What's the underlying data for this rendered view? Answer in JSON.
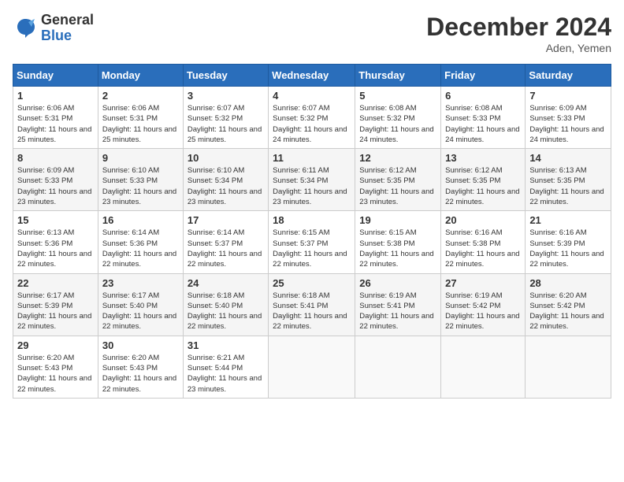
{
  "logo": {
    "general": "General",
    "blue": "Blue"
  },
  "title": "December 2024",
  "location": "Aden, Yemen",
  "days_header": [
    "Sunday",
    "Monday",
    "Tuesday",
    "Wednesday",
    "Thursday",
    "Friday",
    "Saturday"
  ],
  "weeks": [
    [
      {
        "day": "1",
        "sunrise": "6:06 AM",
        "sunset": "5:31 PM",
        "daylight": "11 hours and 25 minutes."
      },
      {
        "day": "2",
        "sunrise": "6:06 AM",
        "sunset": "5:31 PM",
        "daylight": "11 hours and 25 minutes."
      },
      {
        "day": "3",
        "sunrise": "6:07 AM",
        "sunset": "5:32 PM",
        "daylight": "11 hours and 25 minutes."
      },
      {
        "day": "4",
        "sunrise": "6:07 AM",
        "sunset": "5:32 PM",
        "daylight": "11 hours and 24 minutes."
      },
      {
        "day": "5",
        "sunrise": "6:08 AM",
        "sunset": "5:32 PM",
        "daylight": "11 hours and 24 minutes."
      },
      {
        "day": "6",
        "sunrise": "6:08 AM",
        "sunset": "5:33 PM",
        "daylight": "11 hours and 24 minutes."
      },
      {
        "day": "7",
        "sunrise": "6:09 AM",
        "sunset": "5:33 PM",
        "daylight": "11 hours and 24 minutes."
      }
    ],
    [
      {
        "day": "8",
        "sunrise": "6:09 AM",
        "sunset": "5:33 PM",
        "daylight": "11 hours and 23 minutes."
      },
      {
        "day": "9",
        "sunrise": "6:10 AM",
        "sunset": "5:33 PM",
        "daylight": "11 hours and 23 minutes."
      },
      {
        "day": "10",
        "sunrise": "6:10 AM",
        "sunset": "5:34 PM",
        "daylight": "11 hours and 23 minutes."
      },
      {
        "day": "11",
        "sunrise": "6:11 AM",
        "sunset": "5:34 PM",
        "daylight": "11 hours and 23 minutes."
      },
      {
        "day": "12",
        "sunrise": "6:12 AM",
        "sunset": "5:35 PM",
        "daylight": "11 hours and 23 minutes."
      },
      {
        "day": "13",
        "sunrise": "6:12 AM",
        "sunset": "5:35 PM",
        "daylight": "11 hours and 22 minutes."
      },
      {
        "day": "14",
        "sunrise": "6:13 AM",
        "sunset": "5:35 PM",
        "daylight": "11 hours and 22 minutes."
      }
    ],
    [
      {
        "day": "15",
        "sunrise": "6:13 AM",
        "sunset": "5:36 PM",
        "daylight": "11 hours and 22 minutes."
      },
      {
        "day": "16",
        "sunrise": "6:14 AM",
        "sunset": "5:36 PM",
        "daylight": "11 hours and 22 minutes."
      },
      {
        "day": "17",
        "sunrise": "6:14 AM",
        "sunset": "5:37 PM",
        "daylight": "11 hours and 22 minutes."
      },
      {
        "day": "18",
        "sunrise": "6:15 AM",
        "sunset": "5:37 PM",
        "daylight": "11 hours and 22 minutes."
      },
      {
        "day": "19",
        "sunrise": "6:15 AM",
        "sunset": "5:38 PM",
        "daylight": "11 hours and 22 minutes."
      },
      {
        "day": "20",
        "sunrise": "6:16 AM",
        "sunset": "5:38 PM",
        "daylight": "11 hours and 22 minutes."
      },
      {
        "day": "21",
        "sunrise": "6:16 AM",
        "sunset": "5:39 PM",
        "daylight": "11 hours and 22 minutes."
      }
    ],
    [
      {
        "day": "22",
        "sunrise": "6:17 AM",
        "sunset": "5:39 PM",
        "daylight": "11 hours and 22 minutes."
      },
      {
        "day": "23",
        "sunrise": "6:17 AM",
        "sunset": "5:40 PM",
        "daylight": "11 hours and 22 minutes."
      },
      {
        "day": "24",
        "sunrise": "6:18 AM",
        "sunset": "5:40 PM",
        "daylight": "11 hours and 22 minutes."
      },
      {
        "day": "25",
        "sunrise": "6:18 AM",
        "sunset": "5:41 PM",
        "daylight": "11 hours and 22 minutes."
      },
      {
        "day": "26",
        "sunrise": "6:19 AM",
        "sunset": "5:41 PM",
        "daylight": "11 hours and 22 minutes."
      },
      {
        "day": "27",
        "sunrise": "6:19 AM",
        "sunset": "5:42 PM",
        "daylight": "11 hours and 22 minutes."
      },
      {
        "day": "28",
        "sunrise": "6:20 AM",
        "sunset": "5:42 PM",
        "daylight": "11 hours and 22 minutes."
      }
    ],
    [
      {
        "day": "29",
        "sunrise": "6:20 AM",
        "sunset": "5:43 PM",
        "daylight": "11 hours and 22 minutes."
      },
      {
        "day": "30",
        "sunrise": "6:20 AM",
        "sunset": "5:43 PM",
        "daylight": "11 hours and 22 minutes."
      },
      {
        "day": "31",
        "sunrise": "6:21 AM",
        "sunset": "5:44 PM",
        "daylight": "11 hours and 23 minutes."
      },
      null,
      null,
      null,
      null
    ]
  ]
}
